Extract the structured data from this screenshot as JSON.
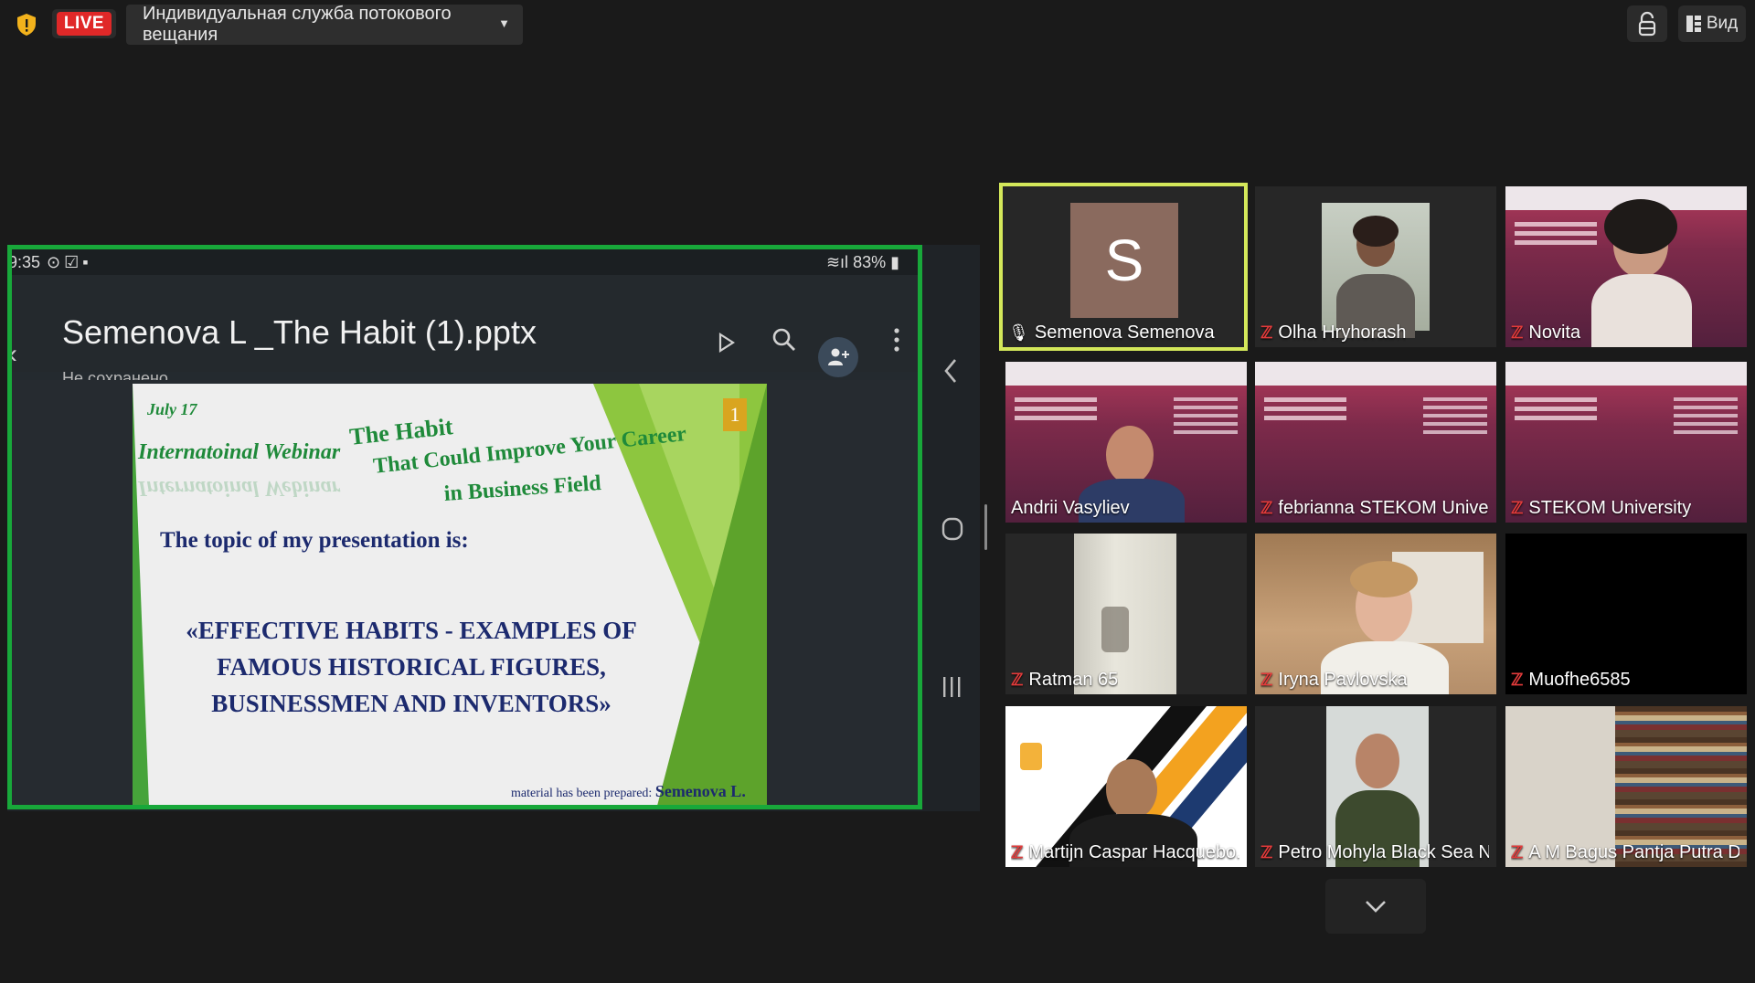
{
  "topbar": {
    "live_label": "LIVE",
    "stream_label": "Индивидуальная служба потокового вещания",
    "view_label": "Вид"
  },
  "share": {
    "status_time": "9:35",
    "battery": "83%",
    "doc_title": "Semenova L _The Habit (1).pptx",
    "doc_status": "Не сохранено",
    "slide": {
      "date": "July 17",
      "number": "1",
      "webinar": "Internatoinal Webinar",
      "habit": "The Habit",
      "career": "That Could Improve Your Career",
      "field": "in Business Field",
      "topic": "The topic of my presentation is:",
      "main_line1": "«EFFECTIVE HABITS -  EXAMPLES OF",
      "main_line2": "FAMOUS HISTORICAL FIGURES,",
      "main_line3": "BUSINESSMEN AND INVENTORS»",
      "credit_prefix": "material has been prepared:",
      "credit_name": "Semenova L."
    }
  },
  "participants": [
    {
      "name": "Semenova Semenova",
      "avatar_letter": "S",
      "mic": "on"
    },
    {
      "name": "Olha Hryhorash",
      "mic": "muted"
    },
    {
      "name": "Novita",
      "mic": "muted"
    },
    {
      "name": "Andrii Vasyliev",
      "mic": "none"
    },
    {
      "name": "febrianna STEKOM Unive...",
      "mic": "muted"
    },
    {
      "name": "STEKOM University",
      "mic": "muted"
    },
    {
      "name": "Ratman 65",
      "mic": "muted"
    },
    {
      "name": "Iryna Pavlovska",
      "mic": "muted"
    },
    {
      "name": "Muofhe6585",
      "mic": "muted"
    },
    {
      "name": "Martijn Caspar Hacquebo...",
      "mic": "muted"
    },
    {
      "name": "Petro Mohyla Black Sea N...",
      "mic": "muted"
    },
    {
      "name": "A M Bagus Pantja Putra D...",
      "mic": "muted"
    }
  ],
  "colors": {
    "live_red": "#e02828",
    "share_border": "#18a83a",
    "active_speaker": "#d4e85a",
    "muted_red": "#e23b3b"
  }
}
